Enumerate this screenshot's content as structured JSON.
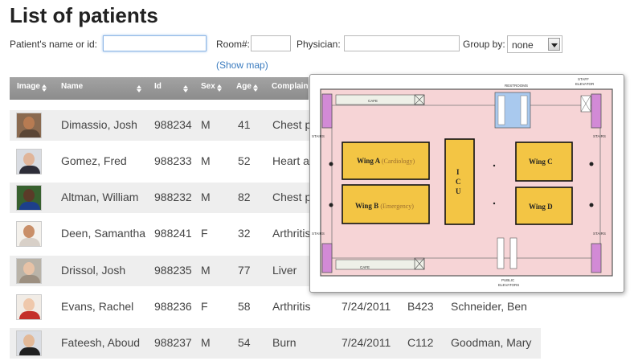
{
  "page": {
    "title": "List of patients"
  },
  "filters": {
    "name_label": "Patient's name or id:",
    "name_value": "",
    "room_label": "Room#:",
    "room_value": "",
    "physician_label": "Physician:",
    "physician_value": "",
    "group_label": "Group by:",
    "group_value": "none",
    "show_map_link": "(Show map)"
  },
  "table": {
    "columns": [
      "Image",
      "Name",
      "Id",
      "Sex",
      "Age",
      "Complain"
    ],
    "rows": [
      {
        "name": "Dimassio, Josh",
        "id": "988234",
        "sex": "M",
        "age": "41",
        "complaint": "Chest p",
        "date": "",
        "room": "",
        "physician": "",
        "skin": "#b77b52",
        "shirt": "#5a4636",
        "bg": "#8a6a50"
      },
      {
        "name": "Gomez, Fred",
        "id": "988233",
        "sex": "M",
        "age": "52",
        "complaint": "Heart a",
        "date": "",
        "room": "",
        "physician": "",
        "skin": "#e0b59a",
        "shirt": "#2d2d38",
        "bg": "#d9dce2"
      },
      {
        "name": "Altman, William",
        "id": "988232",
        "sex": "M",
        "age": "82",
        "complaint": "Chest p",
        "date": "",
        "room": "",
        "physician": "",
        "skin": "#5b3b28",
        "shirt": "#1d3f8a",
        "bg": "#38612f"
      },
      {
        "name": "Deen, Samantha",
        "id": "988241",
        "sex": "F",
        "age": "32",
        "complaint": "Arthritis",
        "date": "",
        "room": "",
        "physician": "",
        "skin": "#c98f68",
        "shirt": "#d8d0c8",
        "bg": "#f4f1ec"
      },
      {
        "name": "Drissol, Josh",
        "id": "988235",
        "sex": "M",
        "age": "77",
        "complaint": "Liver",
        "date": "",
        "room": "",
        "physician": "",
        "skin": "#e7c2a6",
        "shirt": "#9c8f80",
        "bg": "#b9b3a8"
      },
      {
        "name": "Evans, Rachel",
        "id": "988236",
        "sex": "F",
        "age": "58",
        "complaint": "Arthritis",
        "date": "7/24/2011",
        "room": "B423",
        "physician": "Schneider, Ben",
        "skin": "#efc8ab",
        "shirt": "#c4302a",
        "bg": "#f1ece6"
      },
      {
        "name": "Fateesh, Aboud",
        "id": "988237",
        "sex": "M",
        "age": "54",
        "complaint": "Burn",
        "date": "7/24/2011",
        "room": "C112",
        "physician": "Goodman, Mary",
        "skin": "#e3b998",
        "shirt": "#202020",
        "bg": "#dadde3"
      }
    ]
  },
  "map": {
    "wing_a": "Wing A",
    "wing_a_note": "(Cardiology)",
    "wing_b": "Wing B",
    "wing_b_note": "(Emergency)",
    "icu": [
      "I",
      "C",
      "U"
    ],
    "wing_c": "Wing C",
    "wing_d": "Wing D",
    "restrooms": "RESTROOMS",
    "staff_elevator_1": "STAFF",
    "staff_elevator_2": "ELEVATOR",
    "public_elevators_1": "PUBLIC",
    "public_elevators_2": "ELEVATORS",
    "stairs": "STAIRS",
    "cafe": "CAFE",
    "colors": {
      "floor": "#f6d4d6",
      "wing": "#f3c544",
      "stairs": "#d28ad6",
      "restroom": "#a9c9ee"
    }
  }
}
